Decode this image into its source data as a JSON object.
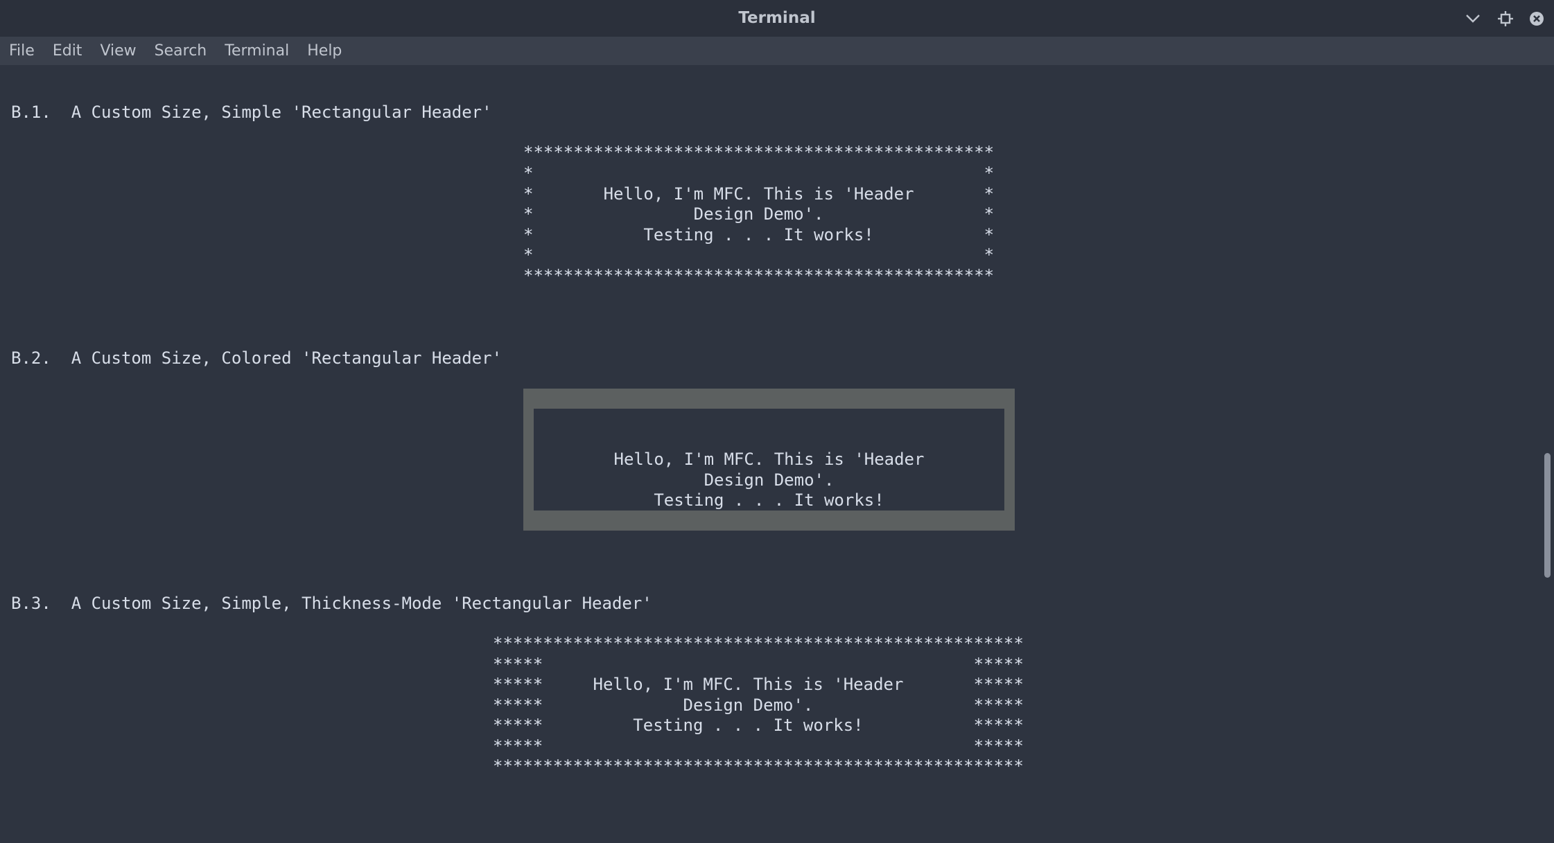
{
  "window": {
    "title": "Terminal",
    "controls": {
      "minimize_icon": "chevron-down-icon",
      "maximize_icon": "maximize-icon",
      "close_icon": "close-icon"
    }
  },
  "menubar": {
    "items": [
      "File",
      "Edit",
      "View",
      "Search",
      "Terminal",
      "Help"
    ]
  },
  "terminal": {
    "section_b1": {
      "heading": "B.1.  A Custom Size, Simple 'Rectangular Header'",
      "lines": [
        "***********************************************",
        "*                                             *",
        "*       Hello, I'm MFC. This is 'Header       *",
        "*                Design Demo'.                *",
        "*           Testing . . . It works!           *",
        "*                                             *",
        "***********************************************"
      ]
    },
    "section_b2": {
      "heading": "B.2.  A Custom Size, Colored 'Rectangular Header'",
      "lines": [
        "Hello, I'm MFC. This is 'Header",
        "Design Demo'.",
        "Testing . . . It works!"
      ]
    },
    "section_b3": {
      "heading": "B.3.  A Custom Size, Simple, Thickness-Mode 'Rectangular Header'",
      "lines": [
        "*****************************************************",
        "*****                                           *****",
        "*****     Hello, I'm MFC. This is 'Header       *****",
        "*****              Design Demo'.                *****",
        "*****         Testing . . . It works!           *****",
        "*****                                           *****",
        "*****************************************************"
      ]
    }
  },
  "colors": {
    "background": "#2e3440",
    "titlebar": "#2b303b",
    "menubar": "#3a404c",
    "text": "#d8dee9",
    "header_box": "#5c6060"
  }
}
